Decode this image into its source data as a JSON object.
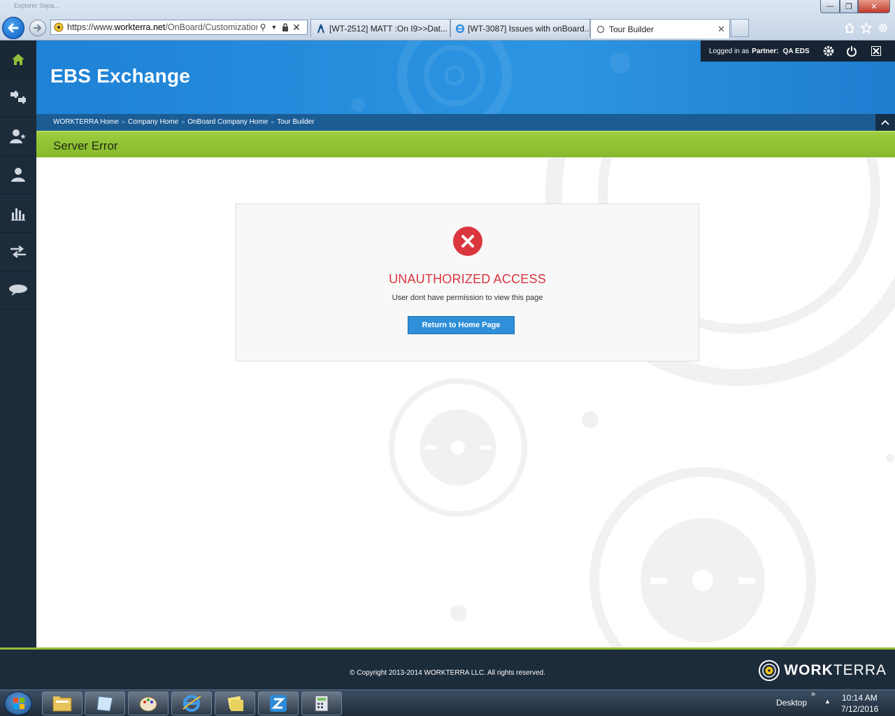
{
  "browser": {
    "window_title": "Explorer Sepa...",
    "address": {
      "prefix": "https://www.",
      "domain": "workterra.net",
      "path": "/OnBoard/Customizatior"
    },
    "tabs": [
      {
        "label": "[WT-2512] MATT :On I9>>Dat...",
        "icon": "jira-icon"
      },
      {
        "label": "[WT-3087] Issues with onBoard...",
        "icon": "ie-icon"
      },
      {
        "label": "Tour Builder",
        "icon": "loading-icon"
      }
    ]
  },
  "header": {
    "app_title": "EBS Exchange",
    "logged_in_label": "Logged in as",
    "partner_label": "Partner:",
    "partner_name": "QA EDS"
  },
  "breadcrumb": [
    "WORKTERRA Home",
    "Company Home",
    "OnBoard Company Home",
    "Tour Builder"
  ],
  "breadcrumb_separator": "»",
  "page_title": "Server Error",
  "error": {
    "title": "UNAUTHORIZED ACCESS",
    "message": "User dont have permission to view this page",
    "button_label": "Return to Home Page"
  },
  "footer": {
    "copyright": "© Copyright 2013-2014 WORKTERRA LLC. All rights reserved.",
    "brand_bold": "WORK",
    "brand_light": "TERRA"
  },
  "taskbar": {
    "desktop_label": "Desktop",
    "time": "10:14 AM",
    "date": "7/12/2016"
  },
  "colors": {
    "header_blue": "#2c95e2",
    "nav_dark": "#1d2c3b",
    "accent_green": "#8fbf3a",
    "error_red": "#d9363e",
    "button_blue": "#2f8fd9"
  }
}
